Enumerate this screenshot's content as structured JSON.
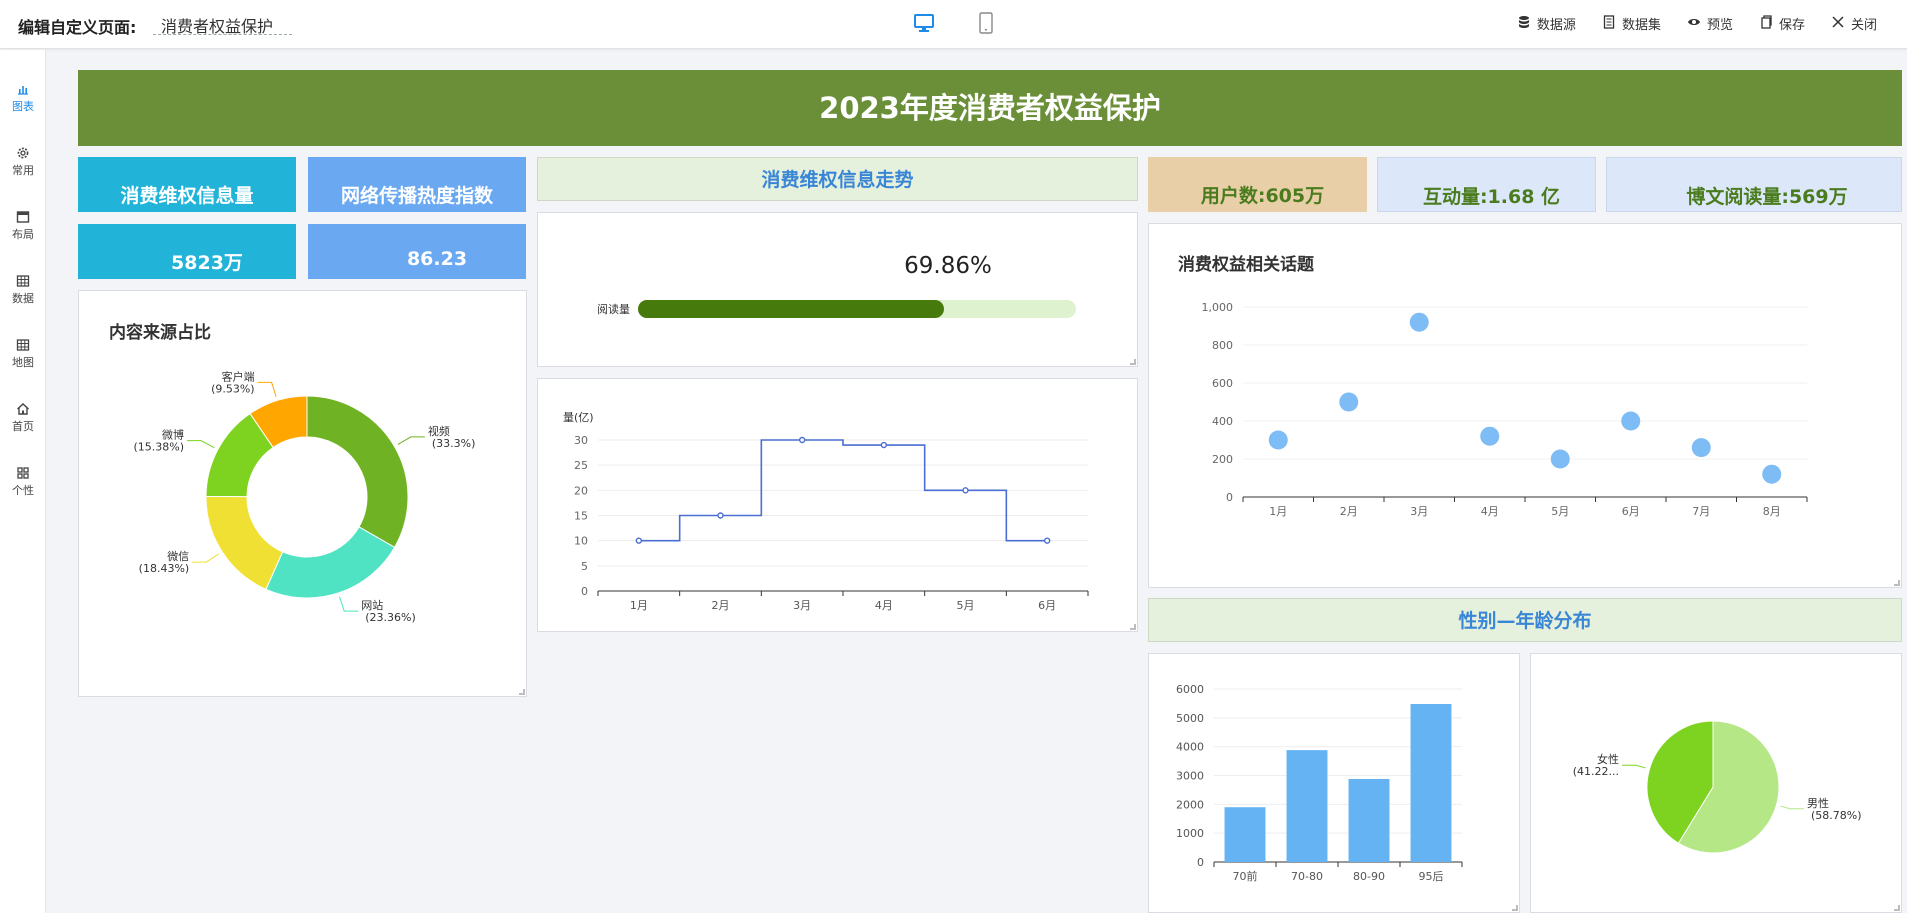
{
  "header": {
    "edit_label": "编辑自定义页面:",
    "page_name": "消费者权益保护",
    "actions": [
      {
        "label": "数据源",
        "icon": "database-icon"
      },
      {
        "label": "数据集",
        "icon": "dataset-icon"
      },
      {
        "label": "预览",
        "icon": "eye-icon"
      },
      {
        "label": "保存",
        "icon": "save-icon"
      },
      {
        "label": "关闭",
        "icon": "close-icon"
      }
    ]
  },
  "sidebar": {
    "items": [
      {
        "label": "图表",
        "icon": "chart-icon"
      },
      {
        "label": "常用",
        "icon": "gear-icon"
      },
      {
        "label": "布局",
        "icon": "layout-icon"
      },
      {
        "label": "数据",
        "icon": "table-icon"
      },
      {
        "label": "地图",
        "icon": "map-grid-icon"
      },
      {
        "label": "首页",
        "icon": "home-icon"
      },
      {
        "label": "个性",
        "icon": "apps-icon"
      }
    ]
  },
  "colors": {
    "accent": "#1f8be8",
    "banner": "#6a8f38",
    "teal": "#21b3d8",
    "blue": "#6aa9f2",
    "header_green": "#e6f1dd"
  },
  "dashboard": {
    "title": "2023年度消费者权益保护",
    "stat1_label": "消费维权信息量",
    "stat1_value": "5823万",
    "stat2_label": "网络传播热度指数",
    "stat2_value": "86.23",
    "trend_header": "消费维权信息走势",
    "kpi_users": "用户数:605万",
    "kpi_interact": "互动量:1.68 亿",
    "kpi_reads": "博文阅读量:569万",
    "gender_header": "性别—年龄分布"
  },
  "chart_data": [
    {
      "type": "pie",
      "title": "内容来源占比",
      "donut": true,
      "slices": [
        {
          "name": "视频",
          "value": 33.3,
          "label": "(33.3%)",
          "color": "#6fb224"
        },
        {
          "name": "网站",
          "value": 23.36,
          "label": "(23.36%)",
          "color": "#4fe3c4"
        },
        {
          "name": "微信",
          "value": 18.43,
          "label": "(18.43%)",
          "color": "#f1e034"
        },
        {
          "name": "微博",
          "value": 15.38,
          "label": "(15.38%)",
          "color": "#7ed321"
        },
        {
          "name": "客户端",
          "value": 9.53,
          "label": "(9.53%)",
          "color": "#ffa600"
        }
      ]
    },
    {
      "type": "bar",
      "subtype": "progress",
      "category": "阅读量",
      "value": 69.86,
      "value_label": "69.86%",
      "max": 100,
      "fill": "#467a0c",
      "track": "#dff2cf"
    },
    {
      "type": "line",
      "step": true,
      "ylabel": "量(亿)",
      "categories": [
        "1月",
        "2月",
        "3月",
        "4月",
        "5月",
        "6月"
      ],
      "values": [
        10,
        15,
        30,
        29,
        20,
        10
      ],
      "ylim": [
        0,
        30
      ],
      "yticks": [
        0,
        5,
        10,
        15,
        20,
        25,
        30
      ],
      "color": "#4a6ed2"
    },
    {
      "type": "scatter",
      "title": "消费权益相关话题",
      "categories": [
        "1月",
        "2月",
        "3月",
        "4月",
        "5月",
        "6月",
        "7月",
        "8月"
      ],
      "values": [
        300,
        500,
        920,
        320,
        200,
        400,
        260,
        120
      ],
      "ylim": [
        0,
        1000
      ],
      "yticks": [
        0,
        200,
        400,
        600,
        800,
        1000
      ],
      "ytick_labels": [
        "0",
        "200",
        "400",
        "600",
        "800",
        "1,000"
      ],
      "color": "#7ebcf5"
    },
    {
      "type": "bar",
      "categories": [
        "70前",
        "70-80",
        "80-90",
        "95后"
      ],
      "values": [
        1900,
        3880,
        2880,
        5480
      ],
      "ylim": [
        0,
        6000
      ],
      "yticks": [
        0,
        1000,
        2000,
        3000,
        4000,
        5000,
        6000
      ],
      "color": "#66b3f4"
    },
    {
      "type": "pie",
      "slices": [
        {
          "name": "男性",
          "value": 58.78,
          "label": "(58.78%)",
          "color": "#b5e786"
        },
        {
          "name": "女性",
          "value": 41.22,
          "label": "(41.22...",
          "color": "#7ed321"
        }
      ]
    }
  ]
}
